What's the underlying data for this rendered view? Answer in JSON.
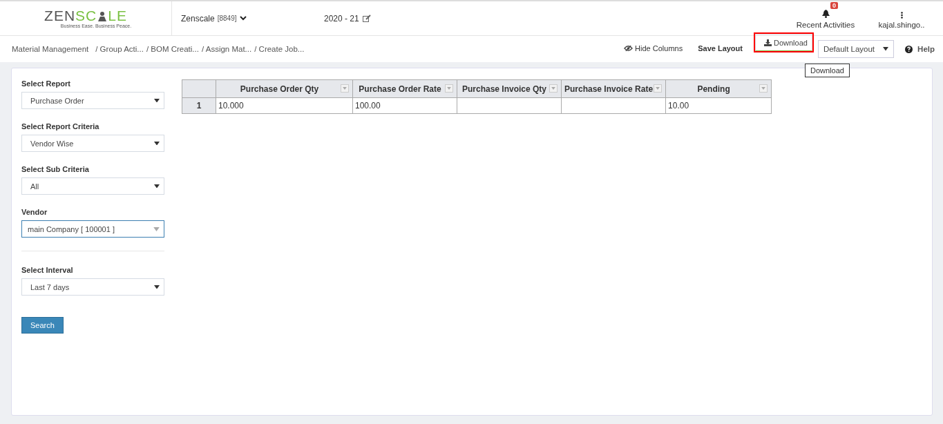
{
  "header": {
    "logo": {
      "part_1": "ZEN",
      "part_2": "SC",
      "part_3": "LE",
      "tagline": "Business Ease. Business Peace."
    },
    "company": "Zenscale",
    "company_code": "[8849]",
    "year": "2020 - 21",
    "notifications": {
      "label": "Recent Activities",
      "count": "0"
    },
    "user": "kajal.shingo.."
  },
  "breadcrumb": [
    "Material Management",
    "/ Group Acti...",
    "/ BOM Creati...",
    "/ Assign Mat...",
    "/ Create Job..."
  ],
  "toolbar": {
    "items": [
      {
        "kind": "hide",
        "label": "Hide Columns",
        "selected": false,
        "highlighted": false
      },
      {
        "kind": "save",
        "label": "Save Layout",
        "selected": false,
        "highlighted": false
      },
      {
        "kind": "download",
        "label": "Download",
        "selected": true,
        "highlighted": true
      }
    ],
    "layout": "Default Layout",
    "help": "Help",
    "tooltip": "Download"
  },
  "filters": [
    {
      "label": "Select Report",
      "value": "Purchase Order",
      "focused": false
    },
    {
      "label": "Select Report Criteria",
      "value": "Vendor Wise",
      "focused": false
    },
    {
      "label": "Select Sub Criteria",
      "value": "All",
      "focused": false
    },
    {
      "label": "Vendor",
      "value": "main Company [ 100001 ]",
      "focused": true
    },
    {
      "label": "Select Interval",
      "value": "Last 7 days",
      "focused": false
    }
  ],
  "search_button": "Search",
  "table": {
    "columns": [
      "Purchase Order Qty",
      "Purchase Order Rate",
      "Purchase Invoice Qty",
      "Purchase Invoice Rate",
      "Pending"
    ],
    "rows": [
      {
        "number": "1",
        "cells": [
          "10.000",
          "100.00",
          "",
          "",
          "10.00"
        ]
      }
    ]
  }
}
